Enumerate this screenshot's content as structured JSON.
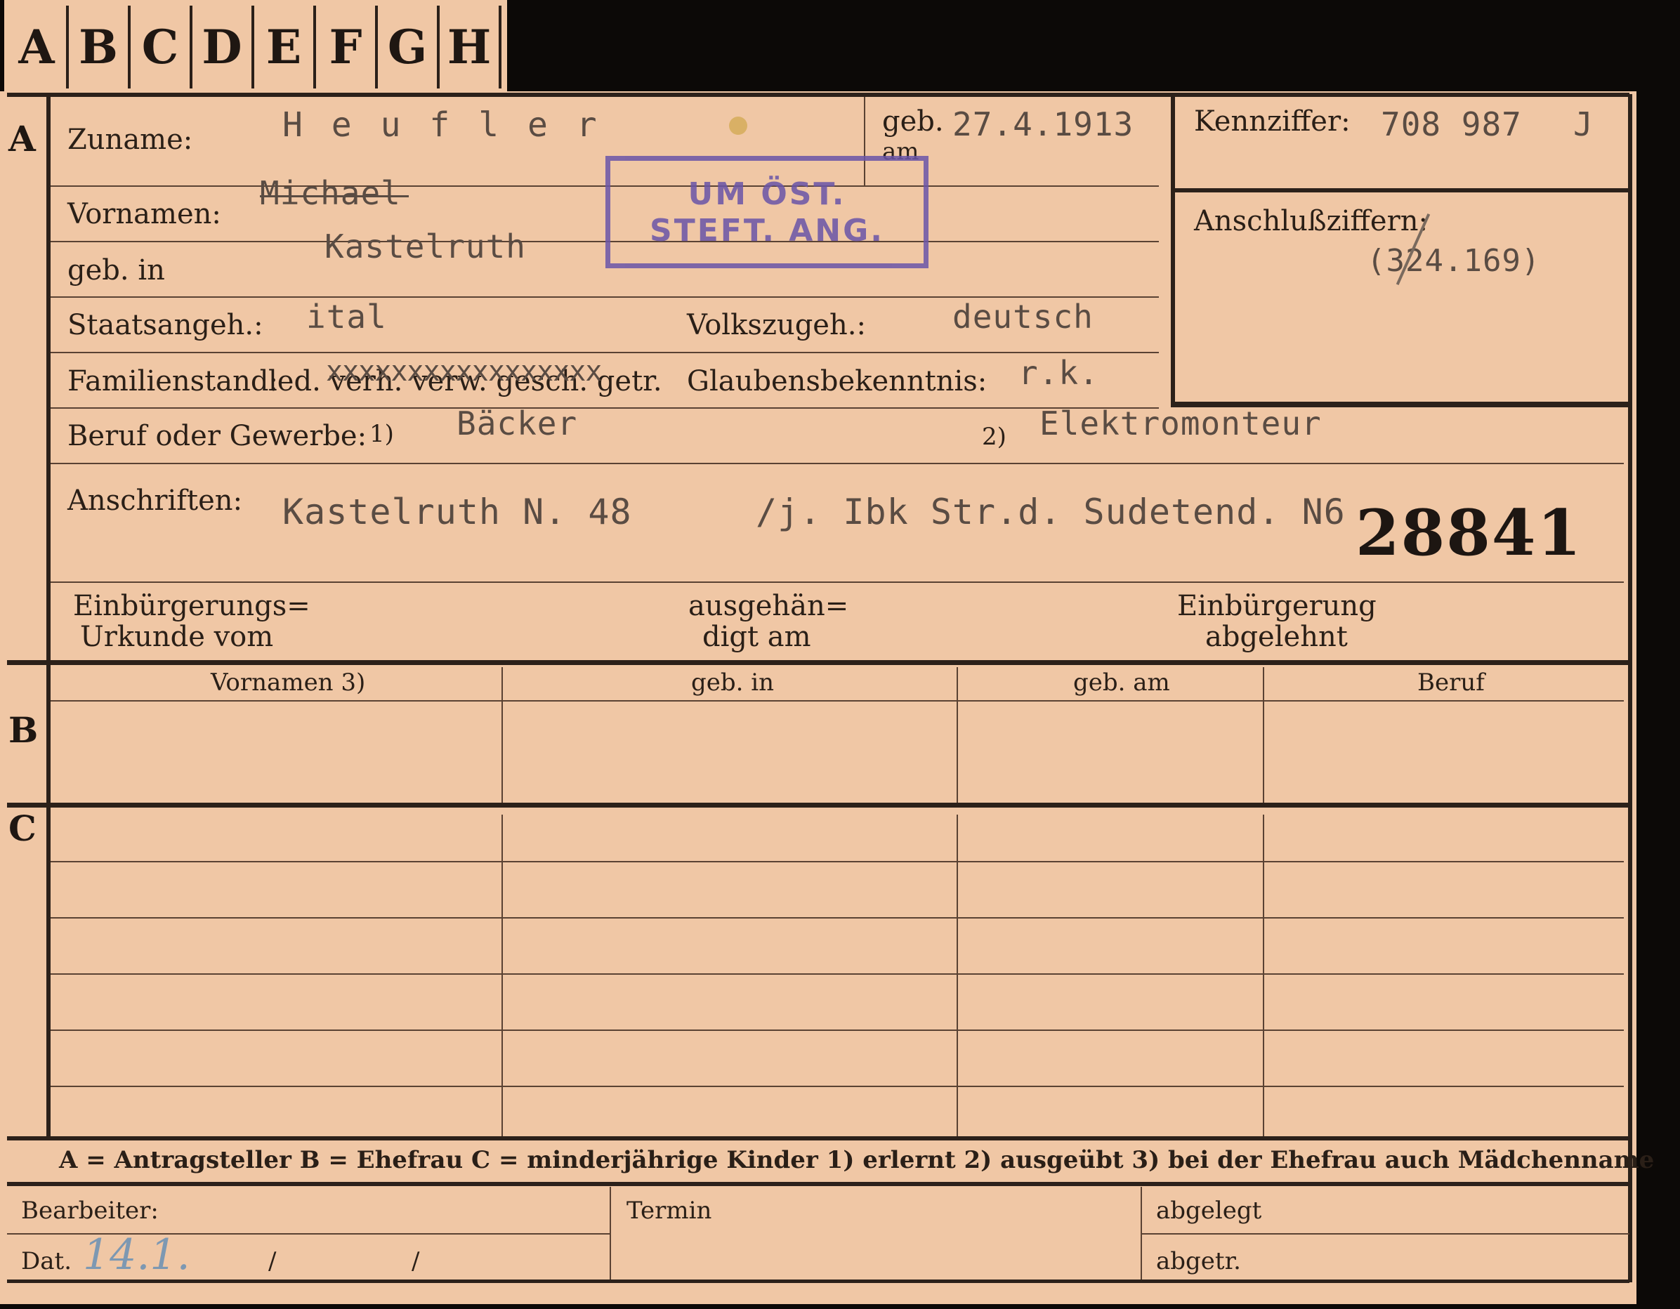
{
  "tabs": [
    "A",
    "B",
    "C",
    "D",
    "E",
    "F",
    "G",
    "H"
  ],
  "sections": {
    "a": "A",
    "b": "B",
    "c": "C"
  },
  "labels": {
    "zuname": "Zuname:",
    "geb_am_1": "geb.",
    "geb_am_2": "am",
    "kennziffer": "Kennziffer:",
    "vornamen": "Vornamen:",
    "anschluss": "Anschlußziffern:",
    "geb_in": "geb. in",
    "staatsangeh": "Staatsangeh.:",
    "volkszugeh": "Volkszugeh.:",
    "familienstand": "Familienstand:",
    "familienstand_options": "led. verh. verw. gesch. getr.",
    "glaubens": "Glaubensbekenntnis:",
    "beruf": "Beruf oder Gewerbe:",
    "beruf_fn1": "1)",
    "beruf_fn2": "2)",
    "anschriften": "Anschriften:",
    "einb_1": "Einbürgerungs=",
    "einb_2": "Urkunde vom",
    "ausgeh_1": "ausgehän=",
    "ausgeh_2": "digt am",
    "einbabg_1": "Einbürgerung",
    "einbabg_2": "abgelehnt",
    "legend": "A = Antragsteller   B = Ehefrau   C = minderjährige Kinder   1) erlernt   2) ausgeübt   3) bei der Ehefrau auch Mädchenname",
    "bearbeiter": "Bearbeiter:",
    "dat": "Dat.",
    "termin": "Termin",
    "abgelegt": "abgelegt",
    "abgetr": "abgetr."
  },
  "table_headers": [
    "Vornamen 3)",
    "geb. in",
    "geb. am",
    "Beruf"
  ],
  "values": {
    "zuname": "H e u f l e r",
    "geb_am": "27.4.1913",
    "kennziffer": "708 987",
    "kennziffer_suffix": "J",
    "anschluss": "(324.169)",
    "vornamen": "Michael",
    "geb_in": "Kastelruth",
    "staatsangeh": "ital",
    "volkszugeh": "deutsch",
    "familienstand_mark": "xxxxxxxxxxxxxxxxx",
    "glaubens": "r.k.",
    "beruf_1": "Bäcker",
    "beruf_2": "Elektromonteur",
    "anschrift_1": "Kastelruth N. 48",
    "anschrift_2": "/j. Ibk Str.d. Sudetend. N6",
    "card_number": "28841",
    "dat_hand": "14.1.",
    "dat_slash1": "/",
    "dat_slash2": "/"
  },
  "stamp": {
    "line1": "UM ÖST.",
    "line2": "STEFT. ANG."
  },
  "colors": {
    "card": "#f0c7a5",
    "ink": "#2a1f17",
    "typewriter": "#5a4c43",
    "stamp": "#6a55a8",
    "handwriting": "#7d98b2",
    "background": "#0c0907"
  }
}
